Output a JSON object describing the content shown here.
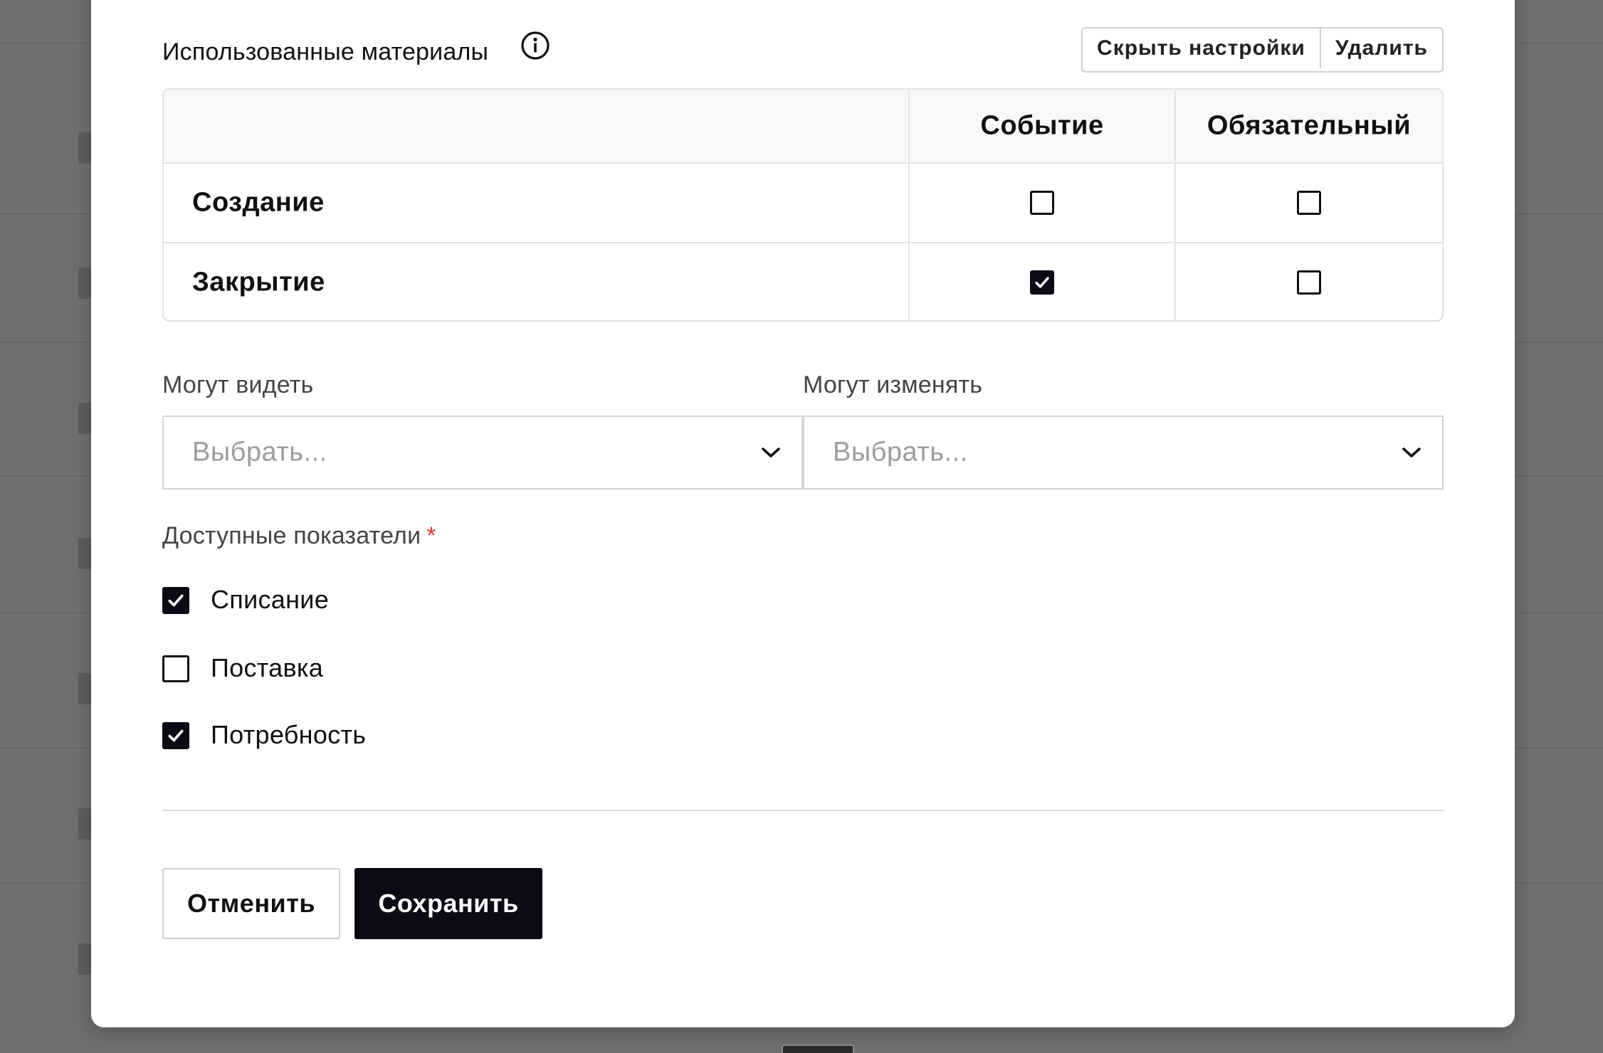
{
  "section": {
    "title": "Использованные материалы",
    "hide_settings_label": "Скрыть настройки",
    "delete_label": "Удалить"
  },
  "table": {
    "columns": [
      "",
      "Событие",
      "Обязательный"
    ],
    "rows": [
      {
        "label": "Создание",
        "event": false,
        "required": false
      },
      {
        "label": "Закрытие",
        "event": true,
        "required": false
      }
    ]
  },
  "permissions": {
    "can_view_label": "Могут видеть",
    "can_view_placeholder": "Выбрать...",
    "can_edit_label": "Могут изменять",
    "can_edit_placeholder": "Выбрать..."
  },
  "indicators": {
    "label": "Доступные показатели",
    "required_mark": "*",
    "items": [
      {
        "label": "Списание",
        "checked": true
      },
      {
        "label": "Поставка",
        "checked": false
      },
      {
        "label": "Потребность",
        "checked": true
      }
    ]
  },
  "actions": {
    "cancel_label": "Отменить",
    "save_label": "Сохранить"
  },
  "colors": {
    "accent": "#0b0b16",
    "required": "#e53935",
    "overlay": "#6f6f6f"
  }
}
